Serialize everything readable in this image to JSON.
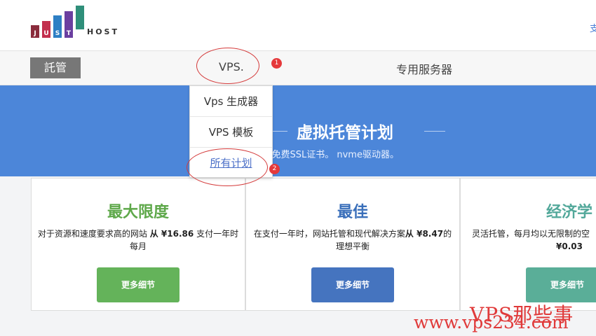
{
  "logo": {
    "letters": [
      "J",
      "U",
      "S",
      "T"
    ],
    "text": "HOST",
    "colors": [
      "#8a2c3c",
      "#c2304e",
      "#2e7fc4",
      "#6b3fa0",
      "#2f8f7a"
    ]
  },
  "header": {
    "edge_text": "支"
  },
  "nav": {
    "active_label": "託管",
    "vps_label": "VPS.",
    "dedicated_label": "专用服务器"
  },
  "dropdown": {
    "items": [
      {
        "label": "Vps 生成器"
      },
      {
        "label": "VPS 模板"
      },
      {
        "label": "所有计划"
      }
    ]
  },
  "hero": {
    "title": "虚拟托管计划",
    "subtitle": "OS保护。免费SSL证书。 nvme驱动器。"
  },
  "cards": [
    {
      "title": "最大限度",
      "title_color": "#5ea84a",
      "desc_pre": "对于资源和速度要求高的网站 ",
      "desc_bold": "从 ¥16.86",
      "desc_post": " 支付一年时每月",
      "button": "更多细节",
      "button_color": "#64b35a"
    },
    {
      "title": "最佳",
      "title_color": "#3a6fba",
      "desc_pre": "在支付一年时，网站托管和现代解决方案",
      "desc_bold": "从 ¥8.47",
      "desc_post": "的理想平衡",
      "button": "更多细节",
      "button_color": "#4574bf"
    },
    {
      "title": "经济学",
      "title_color": "#52a89a",
      "desc_pre": "灵活托管，每月均以无限制的空",
      "desc_bold": "¥0.03",
      "desc_post": "",
      "button": "更多细节",
      "button_color": "#5aae98"
    }
  ],
  "annotations": {
    "badge_1": "1",
    "badge_2": "2",
    "color": "#e5393b"
  },
  "watermark": {
    "top": "VPS那些事",
    "bottom": "www.vps234.com"
  }
}
